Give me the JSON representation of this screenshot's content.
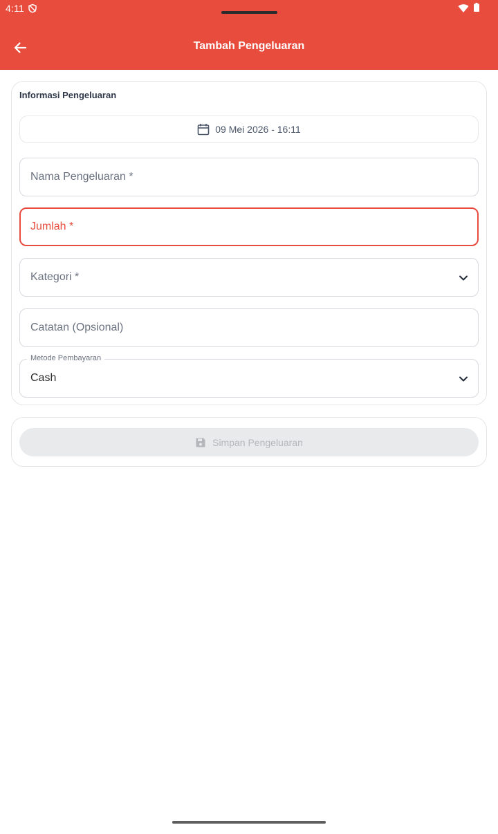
{
  "status_bar": {
    "time": "4:11"
  },
  "header": {
    "title": "Tambah Pengeluaran"
  },
  "form": {
    "section_title": "Informasi Pengeluaran",
    "date_value": "09 Mei 2026 - 16:11",
    "name_label": "Nama Pengeluaran *",
    "amount_label": "Jumlah *",
    "category_label": "Kategori *",
    "notes_label": "Catatan (Opsional)",
    "payment_method": {
      "label": "Metode Pembayaran",
      "value": "Cash"
    }
  },
  "actions": {
    "save_label": "Simpan Pengeluaran"
  },
  "colors": {
    "primary": "#E84C3D",
    "text": "#2d3748",
    "disabled": "#b3b6ba"
  }
}
